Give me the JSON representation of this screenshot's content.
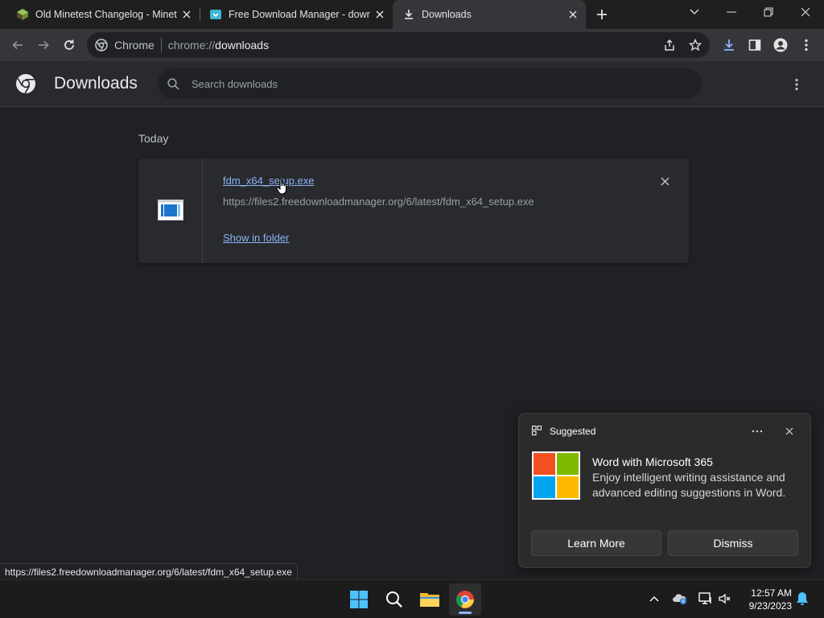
{
  "browser": {
    "tabs": [
      {
        "title": "Old Minetest Changelog - Minetest",
        "icon": "minetest-favicon",
        "active": false
      },
      {
        "title": "Free Download Manager - download",
        "icon": "fdm-favicon",
        "active": false
      },
      {
        "title": "Downloads",
        "icon": "download-icon",
        "active": true
      }
    ],
    "omnibox": {
      "site_label": "Chrome",
      "url_scheme": "chrome://",
      "url_host": "downloads"
    }
  },
  "downloads_page": {
    "title": "Downloads",
    "search_placeholder": "Search downloads",
    "section_label": "Today",
    "items": [
      {
        "file_name": "fdm_x64_setup.exe",
        "url": "https://files2.freedownloadmanager.org/6/latest/fdm_x64_setup.exe",
        "action_label": "Show in folder"
      }
    ]
  },
  "status_bar": {
    "text": "https://files2.freedownloadmanager.org/6/latest/fdm_x64_setup.exe"
  },
  "notification": {
    "header": "Suggested",
    "title": "Word with Microsoft 365",
    "body": "Enjoy intelligent writing assistance and advanced editing suggestions in Word.",
    "primary_button": "Learn More",
    "secondary_button": "Dismiss",
    "logo_colors": [
      "#f25022",
      "#7fba00",
      "#00a4ef",
      "#ffb900"
    ]
  },
  "taskbar": {
    "time": "12:57 AM",
    "date": "9/23/2023"
  },
  "colors": {
    "accent_link": "#8ab4f8",
    "background": "#202124",
    "card": "#292a2d"
  }
}
